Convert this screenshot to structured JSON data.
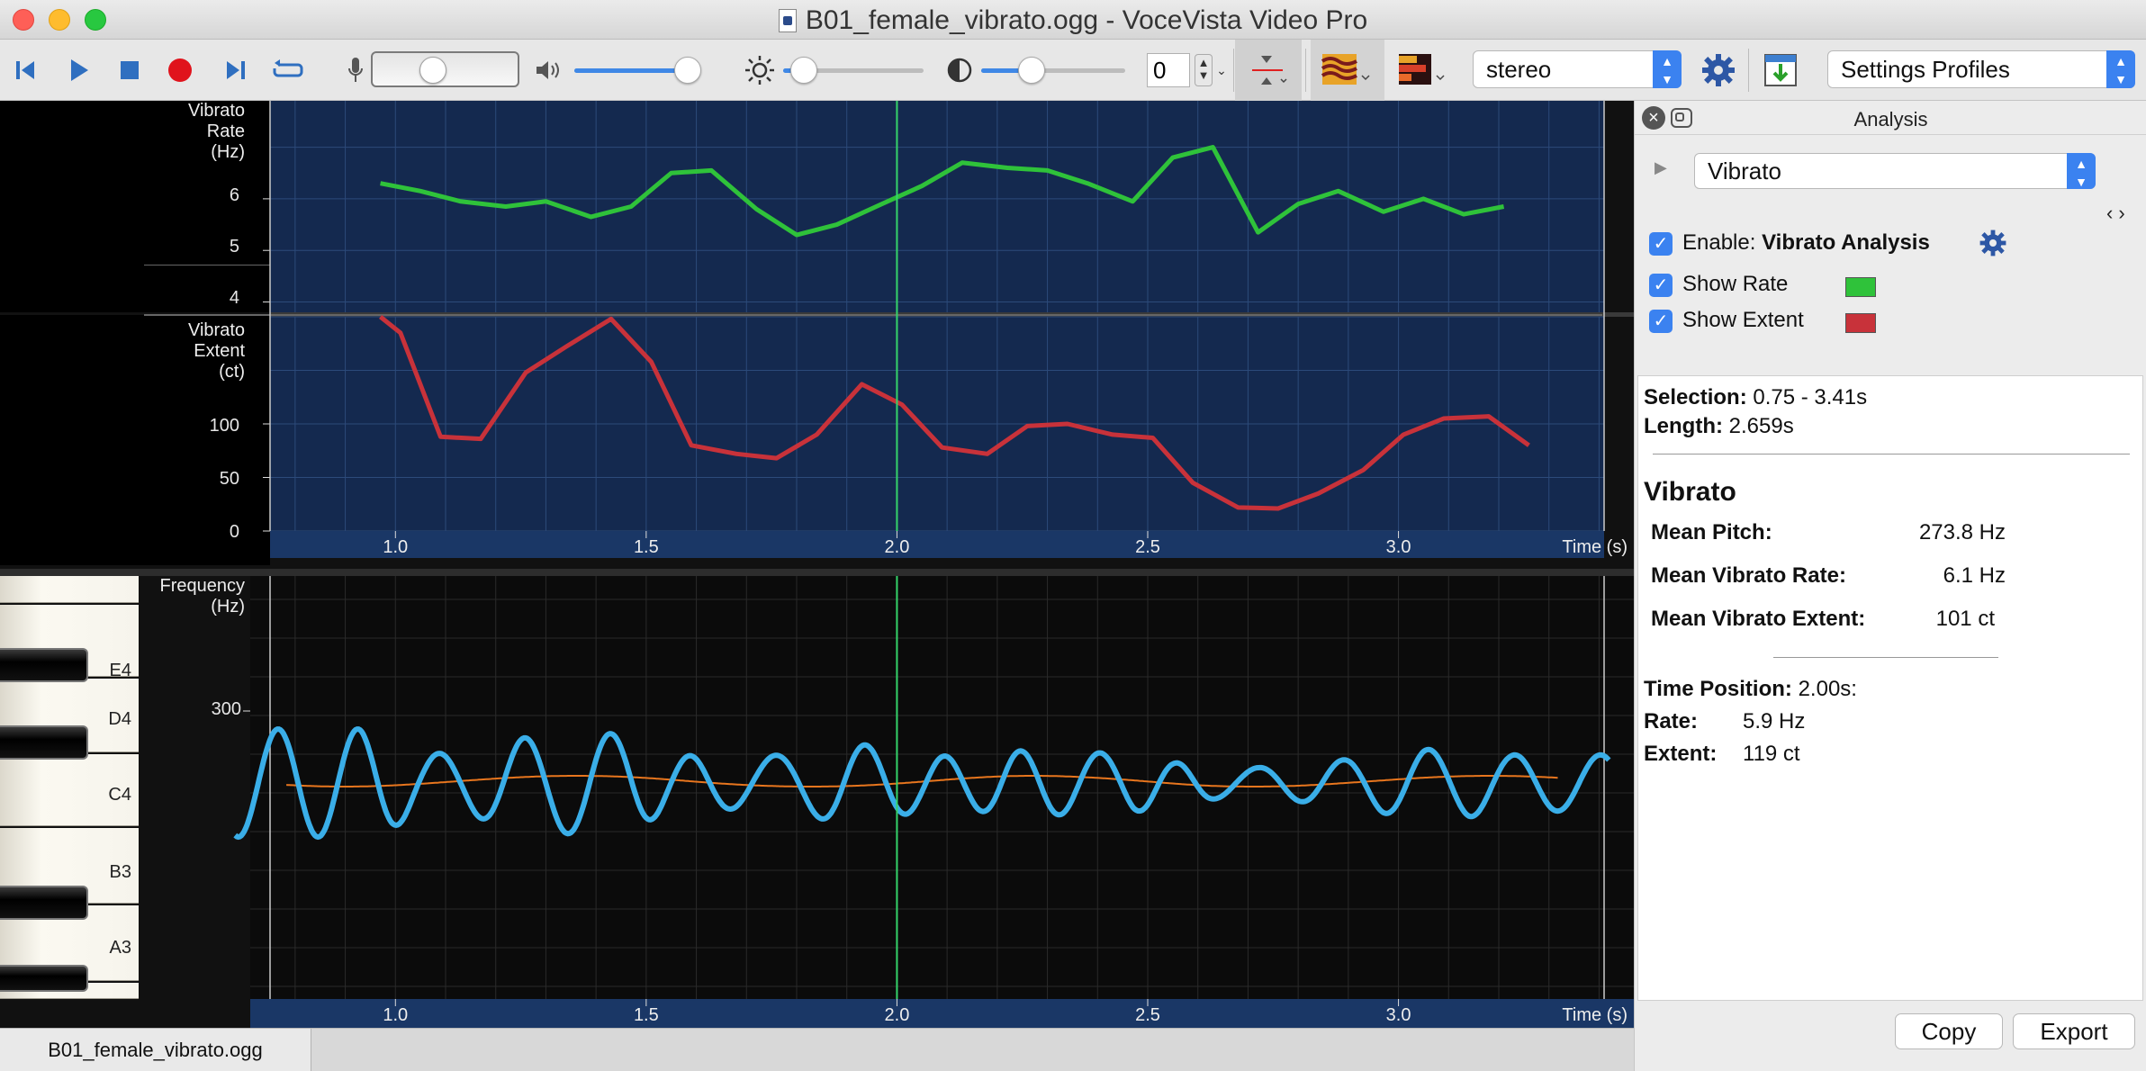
{
  "window": {
    "title": "B01_female_vibrato.ogg - VoceVista Video Pro"
  },
  "toolbar": {
    "number_value": "0",
    "channel_select": "stereo",
    "settings_profiles": "Settings Profiles",
    "volume_level": 0.9,
    "brightness_level": 0.15,
    "contrast_level": 0.35
  },
  "plot": {
    "rate_label": [
      "Vibrato",
      "Rate",
      "(Hz)"
    ],
    "extent_label": [
      "Vibrato",
      "Extent",
      "(ct)"
    ],
    "freq_label": [
      "Frequency",
      "(Hz)"
    ],
    "time_label": "Time (s)",
    "rate_ticks": [
      "6",
      "5",
      "4"
    ],
    "extent_ticks": [
      "100",
      "50",
      "0"
    ],
    "freq_ticks": [
      "300"
    ],
    "time_ticks": [
      "1.0",
      "1.5",
      "2.0",
      "2.5",
      "3.0"
    ],
    "piano_keys": [
      "E4",
      "D4",
      "C4",
      "B3",
      "A3"
    ],
    "cursor_time": 2.0
  },
  "chart_data": [
    {
      "type": "line",
      "xlabel": "Time (s)",
      "ylabel": "Vibrato Rate (Hz)",
      "ylim": [
        3.8,
        7.9
      ],
      "xlim": [
        0.75,
        3.41
      ],
      "series": [
        {
          "color": "#2fc23a",
          "x": [
            0.97,
            1.05,
            1.13,
            1.22,
            1.3,
            1.39,
            1.47,
            1.55,
            1.63,
            1.72,
            1.8,
            1.88,
            1.97,
            2.05,
            2.13,
            2.22,
            2.3,
            2.38,
            2.47,
            2.55,
            2.63,
            2.72,
            2.8,
            2.88,
            2.97,
            3.05,
            3.13,
            3.21
          ],
          "y": [
            6.3,
            6.15,
            5.95,
            5.85,
            5.95,
            5.65,
            5.85,
            6.5,
            6.55,
            5.8,
            5.3,
            5.5,
            5.9,
            6.25,
            6.7,
            6.6,
            6.55,
            6.3,
            5.95,
            6.8,
            7.0,
            5.35,
            5.9,
            6.15,
            5.75,
            6.0,
            5.7,
            5.85
          ]
        }
      ]
    },
    {
      "type": "line",
      "xlabel": "Time (s)",
      "ylabel": "Vibrato Extent (ct)",
      "ylim": [
        0,
        200
      ],
      "xlim": [
        0.75,
        3.41
      ],
      "series": [
        {
          "color": "#c8323a",
          "x": [
            0.97,
            1.01,
            1.09,
            1.17,
            1.26,
            1.34,
            1.43,
            1.51,
            1.59,
            1.68,
            1.76,
            1.84,
            1.93,
            2.01,
            2.09,
            2.18,
            2.26,
            2.34,
            2.43,
            2.51,
            2.59,
            2.68,
            2.76,
            2.84,
            2.93,
            3.01,
            3.09,
            3.18,
            3.26
          ],
          "y": [
            200,
            185,
            88,
            86,
            148,
            172,
            198,
            158,
            80,
            72,
            68,
            90,
            137,
            118,
            78,
            72,
            98,
            100,
            90,
            87,
            45,
            22,
            21,
            35,
            57,
            90,
            105,
            107,
            80
          ]
        }
      ]
    }
  ],
  "analysis": {
    "title": "Analysis",
    "dropdown": "Vibrato",
    "enable_label": "Enable:",
    "enable_name": "Vibrato Analysis",
    "show_rate": "Show Rate",
    "show_extent": "Show Extent",
    "rate_color": "#2fc23a",
    "extent_color": "#c8323a",
    "selection_label": "Selection:",
    "selection_value": "0.75 - 3.41s",
    "length_label": "Length:",
    "length_value": "2.659s",
    "section_title": "Vibrato",
    "mean_pitch_label": "Mean Pitch:",
    "mean_pitch_value": "273.8 Hz",
    "mean_rate_label": "Mean Vibrato Rate:",
    "mean_rate_value": "6.1 Hz",
    "mean_extent_label": "Mean Vibrato Extent:",
    "mean_extent_value": "101 ct",
    "time_pos_label": "Time Position:",
    "time_pos_value": "2.00s:",
    "rate_label": "Rate:",
    "rate_value": "5.9 Hz",
    "extent_label": "Extent:",
    "extent_value": "119 ct",
    "copy": "Copy",
    "export": "Export"
  },
  "tabs": {
    "file": "B01_female_vibrato.ogg"
  }
}
